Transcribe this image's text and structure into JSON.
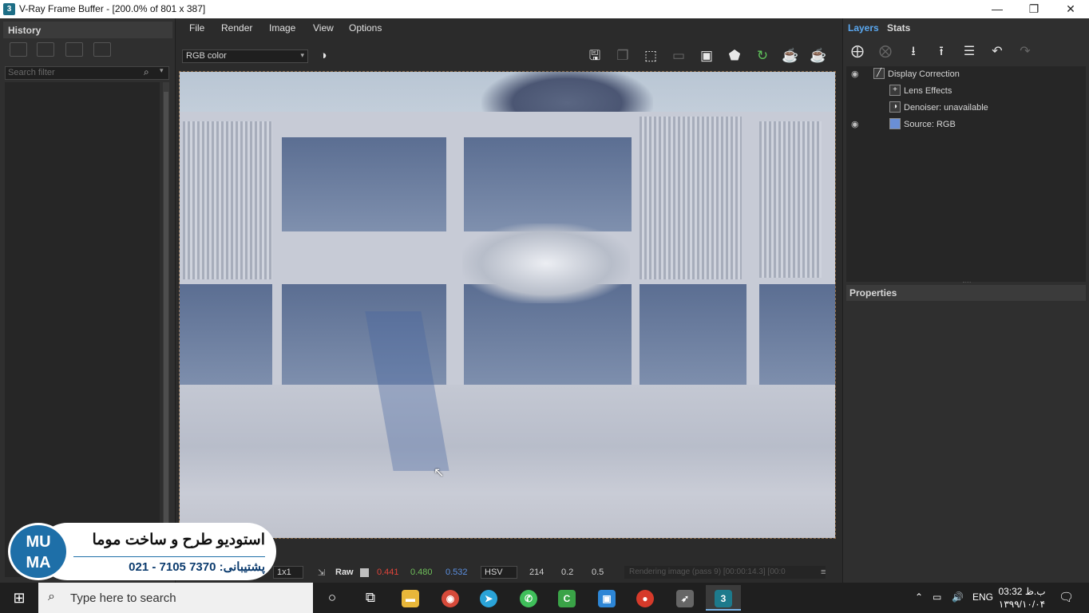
{
  "window": {
    "title": "V-Ray Frame Buffer - [200.0% of 801 x 387]",
    "app_icon": "3",
    "minimize": "—",
    "maximize": "❐",
    "close": "✕"
  },
  "history": {
    "title": "History",
    "search_placeholder": "Search filter",
    "icons": [
      "save-history-icon",
      "compare-ab-icon",
      "load-history-icon",
      "remove-history-icon"
    ]
  },
  "menu": {
    "items": [
      "File",
      "Render",
      "Image",
      "View",
      "Options"
    ]
  },
  "toolbar": {
    "channel": "RGB color",
    "icons": [
      "color-picker-icon",
      "save-image-icon",
      "clone-frame-icon",
      "region-render-icon",
      "stamp-icon",
      "render-region-box-icon",
      "follow-mouse-icon",
      "refresh-interactive-icon",
      "render-icon",
      "stop-render-icon"
    ]
  },
  "status": {
    "zoom": "1x1",
    "raw_label": "Raw",
    "r": "0.441",
    "g": "0.480",
    "b": "0.532",
    "color_space": "HSV",
    "h": "214",
    "s": "0.2",
    "v": "0.5",
    "progress_text": "Rendering image (pass 9) [00:00:14.3] [00:0",
    "colors": {
      "r": "#e0443a",
      "g": "#6fbf5a",
      "b": "#5b8fe0"
    }
  },
  "right": {
    "tabs": [
      "Layers",
      "Stats"
    ],
    "active_tab": "Layers",
    "layers": [
      {
        "label": "Display Correction",
        "visible": true
      },
      {
        "label": "Lens Effects",
        "visible": false
      },
      {
        "label": "Denoiser: unavailable",
        "visible": false
      },
      {
        "label": "Source: RGB",
        "visible": true
      }
    ],
    "properties_title": "Properties"
  },
  "watermark": {
    "logo_top": "MU",
    "logo_bottom": "MA",
    "title": "استودیو طرح و ساخت موما",
    "phone": "021 - 7105 7370 :پشتیبانی"
  },
  "taskbar": {
    "search_placeholder": "Type here to search",
    "language": "ENG",
    "time": "03:32 ب.ظ",
    "date": "۱۳۹۹/۱۰/۰۴",
    "apps": [
      {
        "name": "cortana",
        "glyph": "○"
      },
      {
        "name": "task-view",
        "glyph": "⧉"
      },
      {
        "name": "file-explorer",
        "glyph": "▬"
      },
      {
        "name": "chrome",
        "glyph": "◉"
      },
      {
        "name": "telegram",
        "glyph": "➤"
      },
      {
        "name": "whatsapp",
        "glyph": "✆"
      },
      {
        "name": "camtasia",
        "glyph": "C"
      },
      {
        "name": "store",
        "glyph": "▣"
      },
      {
        "name": "vpn",
        "glyph": "●"
      },
      {
        "name": "launcher",
        "glyph": "➶"
      },
      {
        "name": "3dsmax",
        "glyph": "3"
      }
    ]
  }
}
